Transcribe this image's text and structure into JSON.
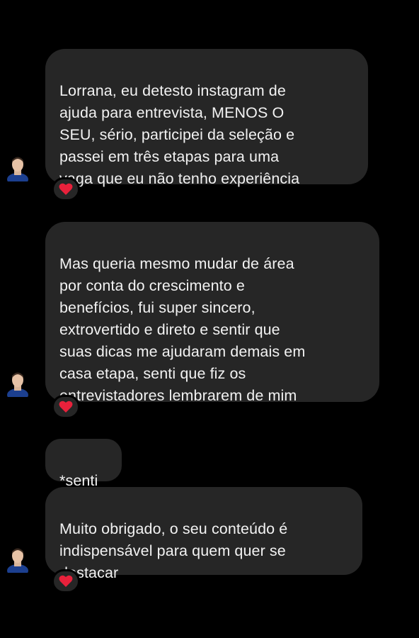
{
  "conversation": {
    "messages": [
      {
        "text": "Lorrana, eu detesto instagram de\najuda para entrevista, MENOS O\nSEU, sério, participei da seleção e\npassei em três etapas para uma\nvaga que eu não tenho experiência",
        "reaction": "heart-icon"
      },
      {
        "text": "Mas queria mesmo mudar de área\npor conta do crescimento e\nbenefícios, fui super sincero,\nextrovertido e direto e sentir que\nsuas dicas me ajudaram demais em\ncasa etapa, senti que fiz os\nentrevistadores lembrarem de mim",
        "reaction": "heart-icon"
      },
      {
        "text": "*senti",
        "reaction": ""
      },
      {
        "text": "Muito obrigado, o seu conteúdo é\nindispensável para quem quer se\ndestacar",
        "reaction": "heart-icon"
      }
    ]
  },
  "colors": {
    "background": "#000000",
    "bubble": "#262626",
    "text": "#f2f2f2",
    "heart": "#e8213b"
  }
}
